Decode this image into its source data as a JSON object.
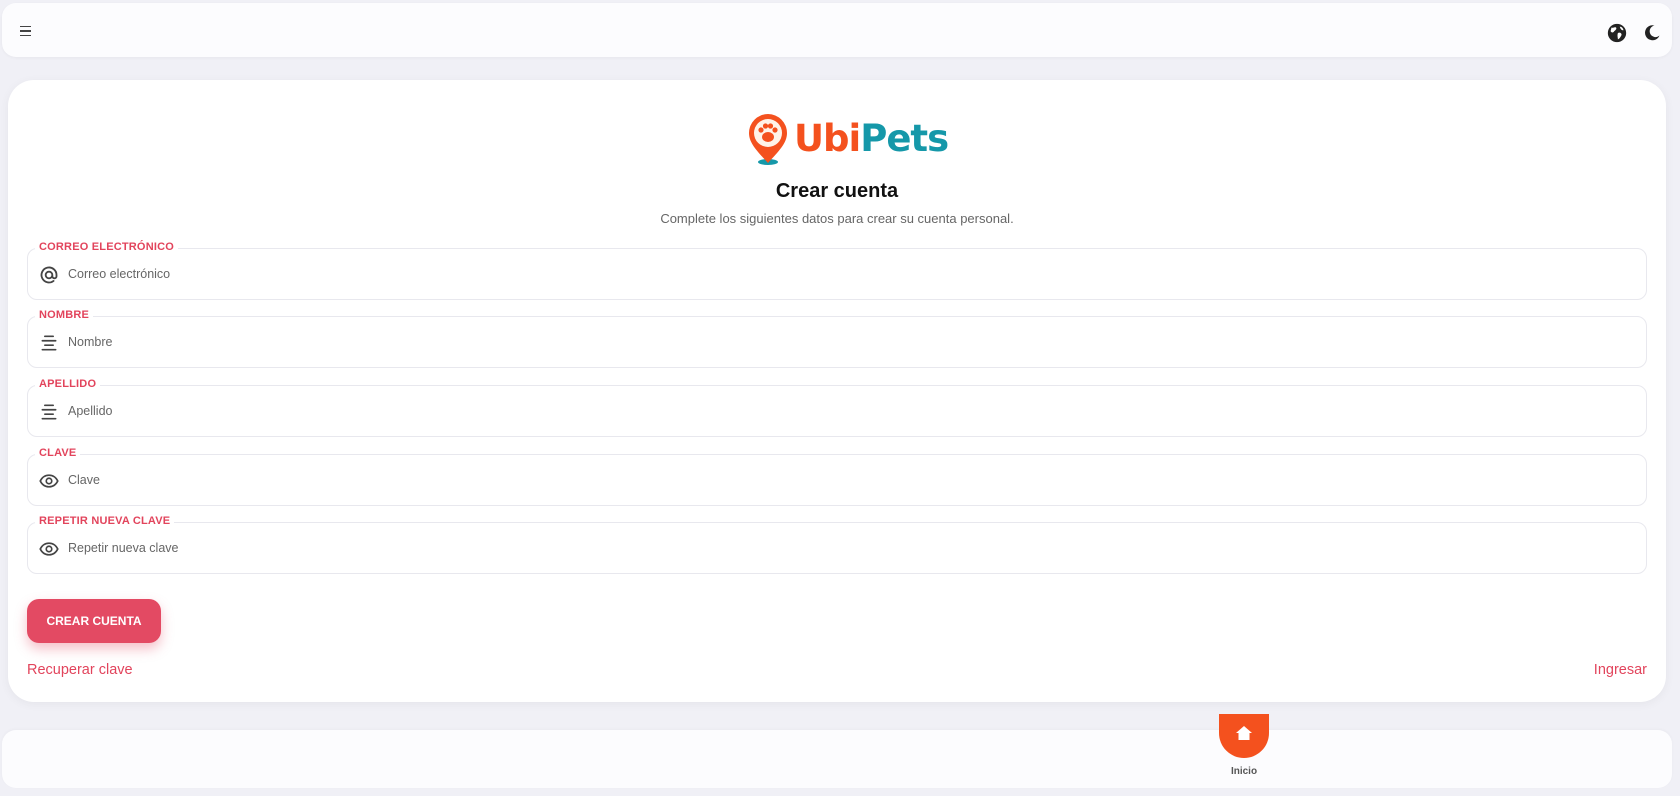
{
  "app": {
    "brand_part1": "Ubi",
    "brand_part2": "Pets",
    "brand_colors": {
      "ubi": "#f4511e",
      "pets": "#1598a9"
    }
  },
  "topbar": {
    "icons": [
      "menu-icon",
      "globe-icon",
      "moon-icon"
    ]
  },
  "form": {
    "title": "Crear cuenta",
    "subtitle": "Complete los siguientes datos para crear su cuenta personal.",
    "fields": [
      {
        "label": "CORREO ELECTRÓNICO",
        "placeholder": "Correo electrónico",
        "value": "",
        "icon": "at-icon"
      },
      {
        "label": "NOMBRE",
        "placeholder": "Nombre",
        "value": "",
        "icon": "align-center-icon"
      },
      {
        "label": "APELLIDO",
        "placeholder": "Apellido",
        "value": "",
        "icon": "align-center-icon"
      },
      {
        "label": "CLAVE",
        "placeholder": "Clave",
        "value": "",
        "icon": "eye-icon"
      },
      {
        "label": "REPETIR NUEVA CLAVE",
        "placeholder": "Repetir nueva clave",
        "value": "",
        "icon": "eye-icon"
      }
    ],
    "submit_label": "CREAR CUENTA",
    "recover_link": "Recuperar clave",
    "login_link": "Ingresar"
  },
  "bottom_nav": {
    "home_label": "Inicio",
    "home_icon": "home-icon",
    "accent": "#f4511e"
  },
  "colors": {
    "accent_red": "#e2445c",
    "button": "#e34a63",
    "background": "#f0f0f6"
  }
}
